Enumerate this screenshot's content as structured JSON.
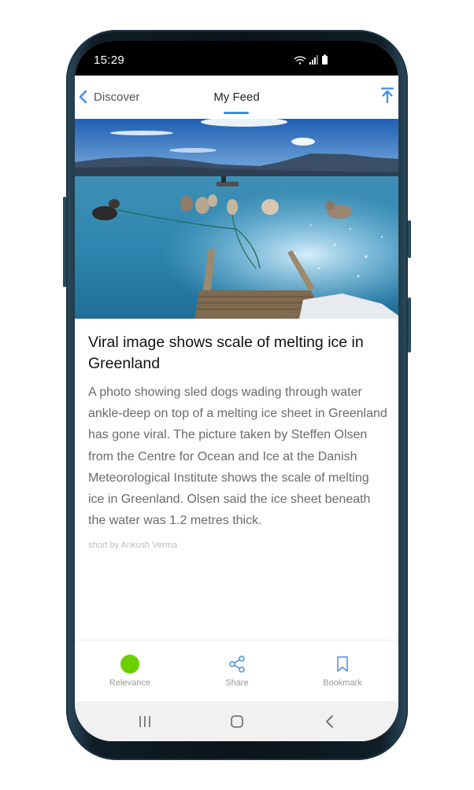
{
  "status_bar": {
    "time": "15:29"
  },
  "header": {
    "back_label": "Discover",
    "title": "My Feed",
    "accent_color": "#3a8ee6"
  },
  "article": {
    "headline": "Viral image shows scale of melting ice in Greenland",
    "body": "A photo showing sled dogs wading through water ankle-deep on top of a melting ice sheet in Greenland has gone viral. The picture taken by Steffen Olsen from the Centre for Ocean and Ice at the Danish Meteorological Institute shows the scale of melting ice in Greenland. Olsen said the ice sheet beneath the water was 1.2 metres thick.",
    "byline": "short by Ankush Verma"
  },
  "toolbar": {
    "relevance_label": "Relevance",
    "share_label": "Share",
    "bookmark_label": "Bookmark",
    "relevance_color": "#6ccf00"
  },
  "icons": [
    "chevron-left-icon",
    "scroll-top-icon",
    "wifi-icon",
    "signal-icon",
    "battery-icon",
    "share-icon",
    "bookmark-icon",
    "recents-icon",
    "home-icon",
    "back-icon"
  ]
}
